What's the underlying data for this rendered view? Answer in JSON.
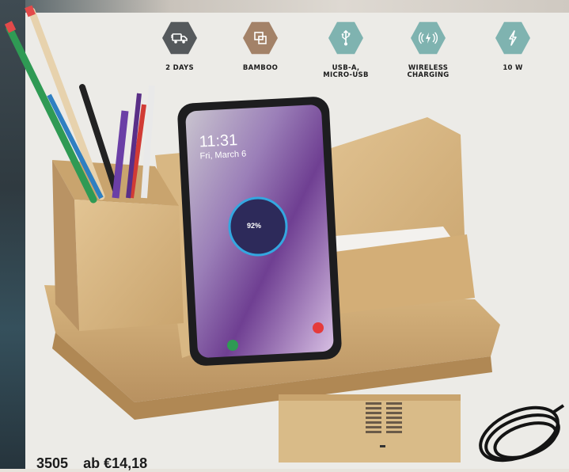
{
  "features": [
    {
      "icon": "truck-icon",
      "label": "2 DAYS",
      "color": "#55595c"
    },
    {
      "icon": "bamboo-icon",
      "label": "BAMBOO",
      "color": "#a38268"
    },
    {
      "icon": "usb-icon",
      "label": "USB-A,\nMICRO-USB",
      "color": "#7fb3b0"
    },
    {
      "icon": "wireless-charging-icon",
      "label": "WIRELESS\nCHARGING",
      "color": "#7fb3b0"
    },
    {
      "icon": "lightning-icon",
      "label": "10 W",
      "color": "#7fb3b0"
    }
  ],
  "phone": {
    "time": "11:31",
    "date": "Fri, March 6",
    "battery": "92%"
  },
  "price": {
    "code": "3505",
    "amount": "ab €14,18"
  }
}
